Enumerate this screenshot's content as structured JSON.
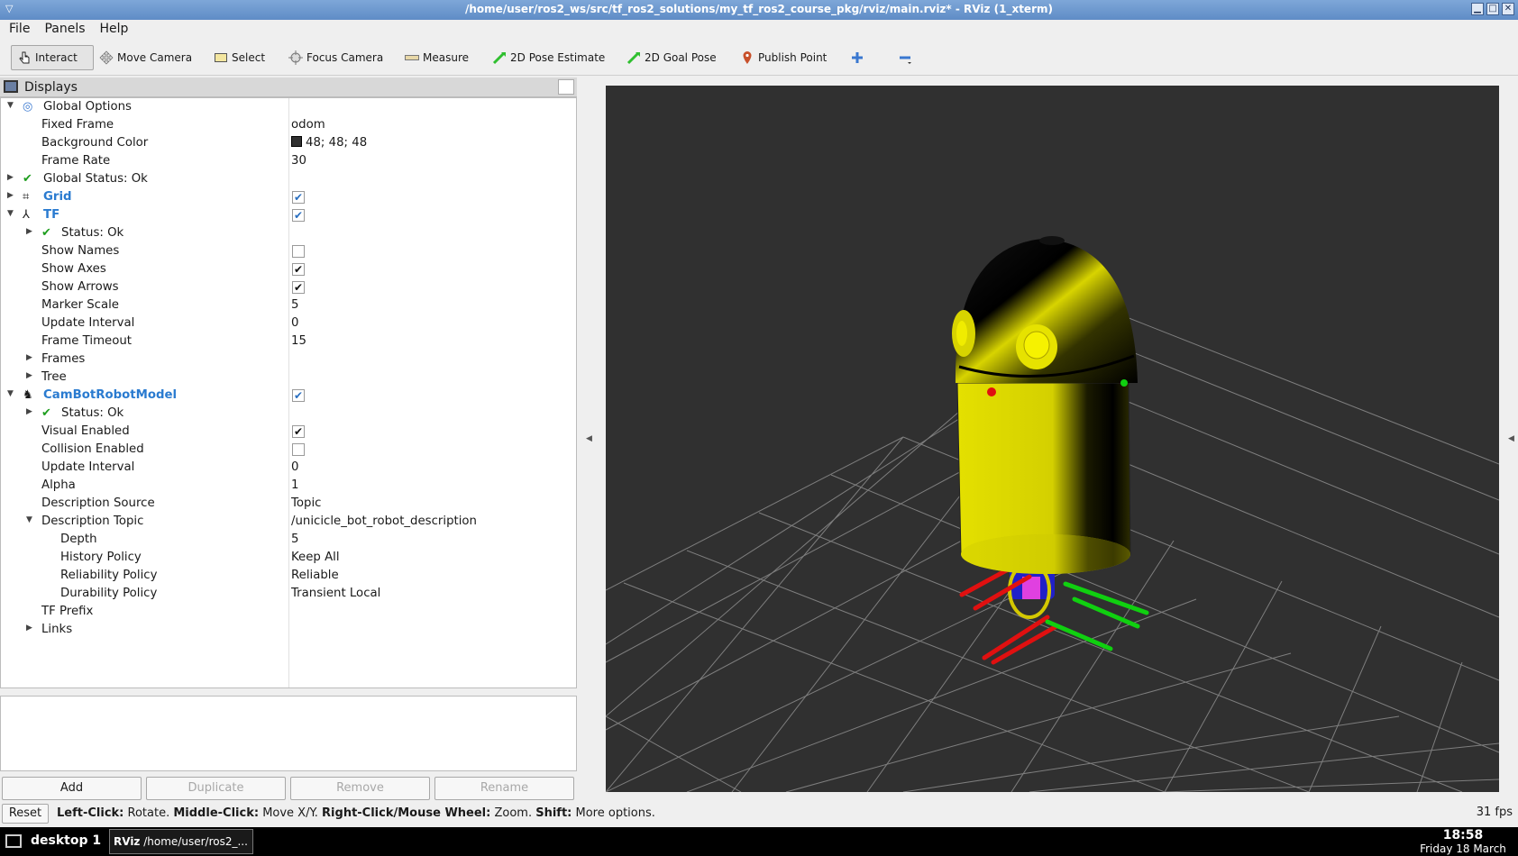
{
  "window": {
    "title": "/home/user/ros2_ws/src/tf_ros2_solutions/my_tf_ros2_course_pkg/rviz/main.rviz* - RViz (1_xterm)"
  },
  "menu": [
    "File",
    "Panels",
    "Help"
  ],
  "toolbar": {
    "tools": [
      "Interact",
      "Move Camera",
      "Select",
      "Focus Camera",
      "Measure",
      "2D Pose Estimate",
      "2D Goal Pose",
      "Publish Point"
    ],
    "active": "Interact"
  },
  "displays_panel": {
    "title": "Displays",
    "rows": [
      {
        "name": "Global Options",
        "value": ""
      },
      {
        "name": "Fixed Frame",
        "value": "odom"
      },
      {
        "name": "Background Color",
        "value": "48; 48; 48"
      },
      {
        "name": "Frame Rate",
        "value": "30"
      },
      {
        "name": "Global Status: Ok",
        "value": ""
      },
      {
        "name": "Grid",
        "value": ""
      },
      {
        "name": "TF",
        "value": ""
      },
      {
        "name": "Status: Ok",
        "value": ""
      },
      {
        "name": "Show Names",
        "value": ""
      },
      {
        "name": "Show Axes",
        "value": ""
      },
      {
        "name": "Show Arrows",
        "value": ""
      },
      {
        "name": "Marker Scale",
        "value": "5"
      },
      {
        "name": "Update Interval",
        "value": "0"
      },
      {
        "name": "Frame Timeout",
        "value": "15"
      },
      {
        "name": "Frames",
        "value": ""
      },
      {
        "name": "Tree",
        "value": ""
      },
      {
        "name": "CamBotRobotModel",
        "value": ""
      },
      {
        "name": "Status: Ok",
        "value": ""
      },
      {
        "name": "Visual Enabled",
        "value": ""
      },
      {
        "name": "Collision Enabled",
        "value": ""
      },
      {
        "name": "Update Interval",
        "value": "0"
      },
      {
        "name": "Alpha",
        "value": "1"
      },
      {
        "name": "Description Source",
        "value": "Topic"
      },
      {
        "name": "Description Topic",
        "value": "/unicicle_bot_robot_description"
      },
      {
        "name": "Depth",
        "value": "5"
      },
      {
        "name": "History Policy",
        "value": "Keep All"
      },
      {
        "name": "Reliability Policy",
        "value": "Reliable"
      },
      {
        "name": "Durability Policy",
        "value": "Transient Local"
      },
      {
        "name": "TF Prefix",
        "value": ""
      },
      {
        "name": "Links",
        "value": ""
      }
    ],
    "checkboxes": {
      "grid": true,
      "tf": true,
      "show_names": false,
      "show_axes": true,
      "show_arrows": true,
      "robot_model": true,
      "visual_enabled": true,
      "collision_enabled": false
    },
    "buttons": {
      "add": "Add",
      "duplicate": "Duplicate",
      "remove": "Remove",
      "rename": "Rename"
    }
  },
  "viewport": {
    "background_color": "#303030"
  },
  "statusbar": {
    "reset": "Reset",
    "hint": [
      {
        "key": "Left-Click:",
        "desc": "Rotate."
      },
      {
        "key": "Middle-Click:",
        "desc": "Move X/Y."
      },
      {
        "key": "Right-Click/Mouse Wheel:",
        "desc": "Zoom."
      },
      {
        "key": "Shift:",
        "desc": "More options."
      }
    ],
    "fps": "31 fps"
  },
  "taskbar": {
    "desktop": "desktop 1",
    "task": "/home/user/ros2_...",
    "task_prefix": "RViz",
    "time": "18:58",
    "date": "Friday 18 March"
  }
}
